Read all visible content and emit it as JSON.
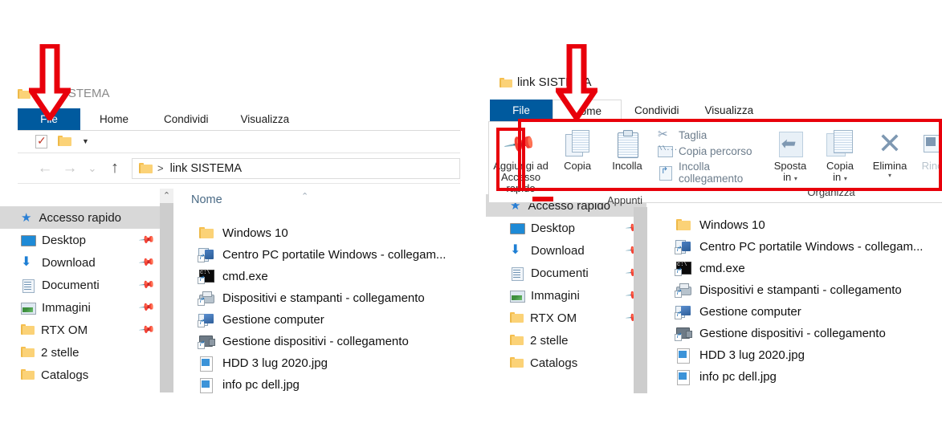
{
  "app": {
    "window_title": "link SISTEMA",
    "tabs": [
      "File",
      "Home",
      "Condividi",
      "Visualizza"
    ],
    "active_tab": "Home",
    "file_tab_label": "File"
  },
  "address_bar": {
    "separator": ">",
    "path_text": "link SISTEMA",
    "back_icon": "back-arrow-icon",
    "forward_icon": "forward-arrow-icon",
    "recent_icon": "chevron-down-icon",
    "up_icon": "up-arrow-icon"
  },
  "quick_access_toolbar": {
    "checkbox_icon": "properties-checkbox-icon",
    "folder_icon": "new-folder-icon",
    "customize_icon": "customize-caret-icon"
  },
  "columns": {
    "name_header": "Nome",
    "sort_indicator": "sort-ascending-caret"
  },
  "nav_pane": {
    "header": {
      "label": "Accesso rapido",
      "icon": "quick-access-star-icon"
    },
    "items": [
      {
        "label": "Desktop",
        "icon": "desktop-icon",
        "pinned": true
      },
      {
        "label": "Download",
        "icon": "download-icon",
        "pinned": true
      },
      {
        "label": "Documenti",
        "icon": "documents-icon",
        "pinned": true
      },
      {
        "label": "Immagini",
        "icon": "pictures-icon",
        "pinned": true
      },
      {
        "label": "RTX  OM",
        "icon": "folder-icon",
        "pinned": true
      },
      {
        "label": "2 stelle",
        "icon": "folder-icon",
        "pinned": false
      },
      {
        "label": "Catalogs",
        "icon": "folder-icon",
        "pinned": false
      }
    ],
    "scroll_up_icon": "scroll-up-caret"
  },
  "files": [
    {
      "name": "Windows 10",
      "icon": "folder-icon"
    },
    {
      "name": "Centro PC portatile Windows - collegam...",
      "icon": "windows-mobility-center-shortcut-icon"
    },
    {
      "name": "cmd.exe",
      "icon": "command-prompt-icon"
    },
    {
      "name": "Dispositivi e stampanti - collegamento",
      "icon": "devices-and-printers-shortcut-icon"
    },
    {
      "name": "Gestione computer",
      "icon": "computer-management-icon"
    },
    {
      "name": "Gestione dispositivi - collegamento",
      "icon": "device-manager-shortcut-icon"
    },
    {
      "name": "HDD  3 lug 2020.jpg",
      "icon": "jpg-image-icon"
    },
    {
      "name": "info pc dell.jpg",
      "icon": "jpg-image-icon"
    }
  ],
  "ribbon": {
    "groups": [
      {
        "label": "Appunti",
        "big_buttons": [
          {
            "line1": "Aggiungi ad",
            "line2": "Accesso rapido",
            "icon": "pin-icon"
          },
          {
            "line1": "Copia",
            "line2": "",
            "icon": "copy-icon"
          },
          {
            "line1": "Incolla",
            "line2": "",
            "icon": "paste-icon"
          }
        ],
        "small_buttons": [
          {
            "label": "Taglia",
            "icon": "scissors-icon"
          },
          {
            "label": "Copia percorso",
            "icon": "copy-path-icon"
          },
          {
            "label": "Incolla collegamento",
            "icon": "paste-shortcut-icon"
          }
        ]
      },
      {
        "label": "Organizza",
        "big_buttons": [
          {
            "line1": "Sposta",
            "line2": "in",
            "icon": "move-to-icon",
            "dropdown": true
          },
          {
            "line1": "Copia",
            "line2": "in",
            "icon": "copy-to-icon",
            "dropdown": true
          },
          {
            "line1": "Elimina",
            "line2": "",
            "icon": "delete-x-icon",
            "dropdown": true
          },
          {
            "line1": "Rino",
            "line2": "",
            "icon": "rename-icon",
            "dropdown": false
          }
        ]
      }
    ]
  },
  "annotations": {
    "arrow_color": "#e8000b",
    "highlight_color": "#e8000b",
    "left_arrow_target": "File tab",
    "right_arrow_target": "Home tab",
    "ribbon_highlight": "Home ribbon bar",
    "pin_button_highlight": "Aggiungi ad Accesso rapido"
  }
}
